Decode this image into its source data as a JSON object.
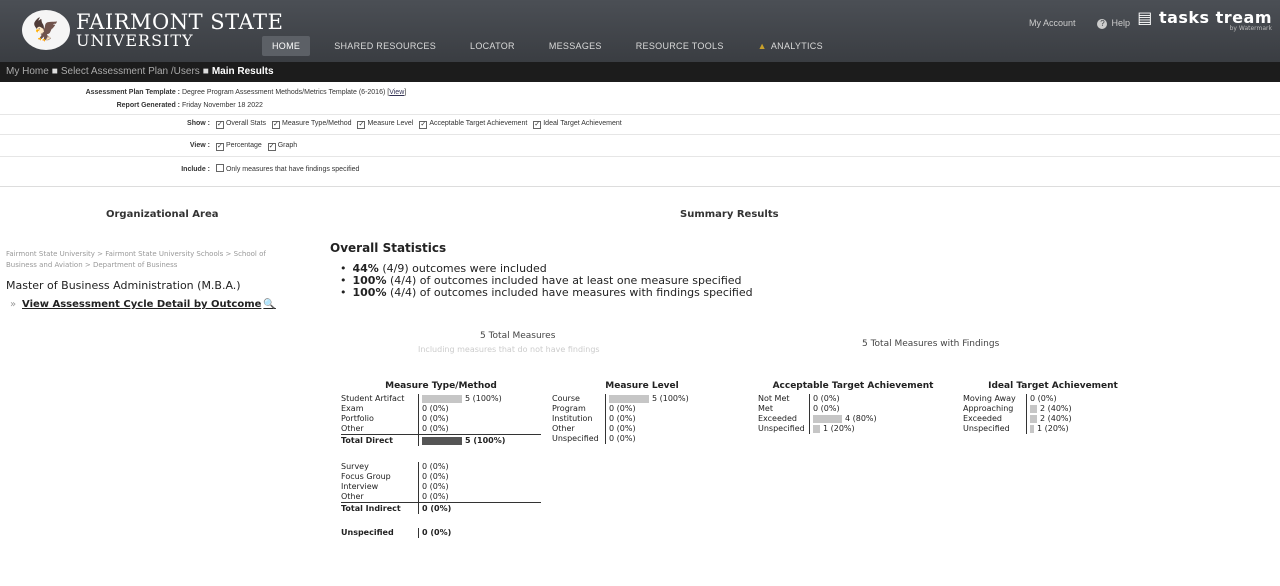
{
  "header": {
    "logo_line1": "FAIRMONT STATE",
    "logo_line2": "UNIVERSITY",
    "nav": [
      {
        "label": "HOME",
        "active": true
      },
      {
        "label": "SHARED RESOURCES",
        "active": false
      },
      {
        "label": "LOCATOR",
        "active": false
      },
      {
        "label": "MESSAGES",
        "active": false
      },
      {
        "label": "RESOURCE TOOLS",
        "active": false
      },
      {
        "label": "ANALYTICS",
        "active": false
      }
    ],
    "my_account": "My Account",
    "help": "Help",
    "brand": "tasks tream",
    "brand_sub": "by Watermark"
  },
  "breadcrumb": {
    "items": [
      "My Home",
      "Select Assessment Plan /Users"
    ],
    "current": "Main Results"
  },
  "info": {
    "template_label": "Assessment Plan Template :",
    "template_value": "Degree Program Assessment Methods/Metrics Template (6-2016)",
    "template_link": "View",
    "generated_label": "Report Generated :",
    "generated_value": "Friday November 18 2022",
    "show_label": "Show :",
    "show_options": [
      "Overall Stats",
      "Measure Type/Method",
      "Measure Level",
      "Acceptable Target Achievement",
      "Ideal Target Achievement"
    ],
    "view_label": "View :",
    "view_options": [
      "Percentage",
      "Graph"
    ],
    "include_label": "Include :",
    "include_option": "Only measures that have findings specified"
  },
  "left": {
    "heading": "Organizational Area",
    "path": "Fairmont State University > Fairmont State University Schools > School of Business and Aviation > Department of Business",
    "program": "Master of Business Administration (M.B.A.)",
    "link": "View Assessment Cycle Detail by Outcome"
  },
  "summary": {
    "heading": "Summary Results",
    "stats_title": "Overall Statistics",
    "stats": [
      {
        "pct": "44%",
        "rest": "(4/9) outcomes were included"
      },
      {
        "pct": "100%",
        "rest": "(4/4) of outcomes included have at least one measure specified"
      },
      {
        "pct": "100%",
        "rest": "(4/4) of outcomes included have measures with findings specified"
      }
    ],
    "total_measures": "5 Total Measures",
    "total_measures_sub": "Including measures that do not have findings",
    "total_with_findings": "5 Total Measures with Findings"
  },
  "measure_type": {
    "title": "Measure Type/Method",
    "direct": [
      {
        "label": "Student Artifact",
        "value": "5 (100%)",
        "pct": 100
      },
      {
        "label": "Exam",
        "value": "0 (0%)",
        "pct": 0
      },
      {
        "label": "Portfolio",
        "value": "0 (0%)",
        "pct": 0
      },
      {
        "label": "Other",
        "value": "0 (0%)",
        "pct": 0
      }
    ],
    "total_direct": {
      "label": "Total Direct",
      "value": "5 (100%)",
      "pct": 100
    },
    "indirect": [
      {
        "label": "Survey",
        "value": "0 (0%)",
        "pct": 0
      },
      {
        "label": "Focus Group",
        "value": "0 (0%)",
        "pct": 0
      },
      {
        "label": "Interview",
        "value": "0 (0%)",
        "pct": 0
      },
      {
        "label": "Other",
        "value": "0 (0%)",
        "pct": 0
      }
    ],
    "total_indirect": {
      "label": "Total Indirect",
      "value": "0 (0%)",
      "pct": 0
    },
    "unspecified": {
      "label": "Unspecified",
      "value": "0 (0%)",
      "pct": 0
    }
  },
  "measure_level": {
    "title": "Measure Level",
    "rows": [
      {
        "label": "Course",
        "value": "5 (100%)",
        "pct": 100
      },
      {
        "label": "Program",
        "value": "0 (0%)",
        "pct": 0
      },
      {
        "label": "Institution",
        "value": "0 (0%)",
        "pct": 0
      },
      {
        "label": "Other",
        "value": "0 (0%)",
        "pct": 0
      },
      {
        "label": "Unspecified",
        "value": "0 (0%)",
        "pct": 0
      }
    ]
  },
  "acceptable": {
    "title": "Acceptable Target Achievement",
    "rows": [
      {
        "label": "Not Met",
        "value": "0 (0%)",
        "pct": 0
      },
      {
        "label": "Met",
        "value": "0 (0%)",
        "pct": 0
      },
      {
        "label": "Exceeded",
        "value": "4 (80%)",
        "pct": 80
      },
      {
        "label": "Unspecified",
        "value": "1 (20%)",
        "pct": 20
      }
    ]
  },
  "ideal": {
    "title": "Ideal Target Achievement",
    "rows": [
      {
        "label": "Moving Away",
        "value": "0 (0%)",
        "pct": 0
      },
      {
        "label": "Approaching",
        "value": "2 (40%)",
        "pct": 40
      },
      {
        "label": "Exceeded",
        "value": "2 (40%)",
        "pct": 40
      },
      {
        "label": "Unspecified",
        "value": "1 (20%)",
        "pct": 20
      }
    ]
  },
  "colors": {
    "header": "#3a3d42",
    "breadcrumb": "#1c1c1c",
    "bar": "#555555"
  }
}
